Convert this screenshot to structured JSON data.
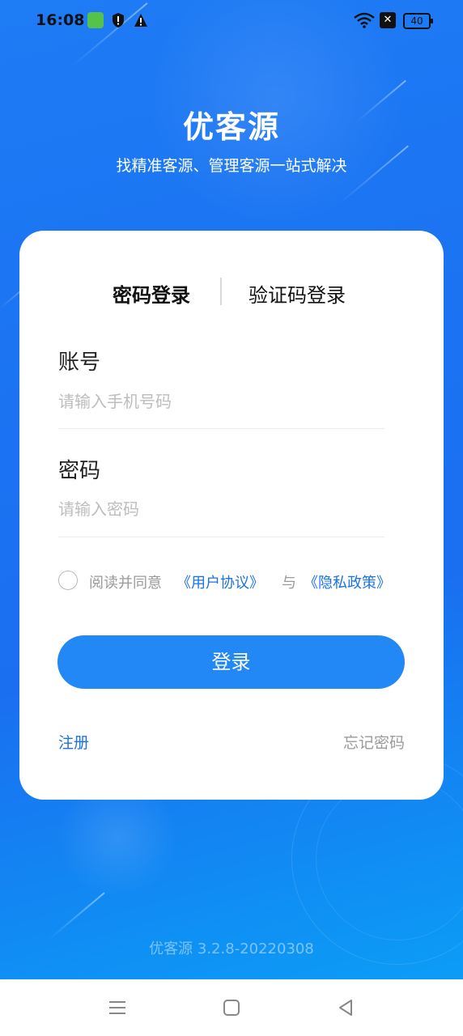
{
  "status_bar": {
    "time": "16:08",
    "battery": "40",
    "icons": [
      "shopping-bag-icon",
      "shield-icon",
      "warning-icon",
      "wifi-icon",
      "x-box-icon",
      "battery-icon"
    ]
  },
  "header": {
    "title": "优客源",
    "subtitle": "找精准客源、管理客源一站式解决"
  },
  "login": {
    "tabs": [
      {
        "label": "密码登录",
        "active": true
      },
      {
        "label": "验证码登录",
        "active": false
      }
    ],
    "account_label": "账号",
    "account_placeholder": "请输入手机号码",
    "account_value": "",
    "password_label": "密码",
    "password_placeholder": "请输入密码",
    "password_value": "",
    "agree_prefix": "阅读并同意",
    "user_agreement": "《用户协议》",
    "agree_and": "与",
    "privacy_policy": "《隐私政策》",
    "agree_checked": false,
    "login_button": "登录",
    "register_link": "注册",
    "forgot_link": "忘记密码"
  },
  "footer": {
    "version": "优客源 3.2.8-20220308"
  },
  "nav_bar": {
    "buttons": [
      "menu-icon",
      "home-icon",
      "back-icon"
    ]
  },
  "colors": {
    "background_top": "#1e7cf5",
    "background_bottom": "#0aa3f7",
    "accent": "#2288f6",
    "link": "#1a72e8"
  }
}
